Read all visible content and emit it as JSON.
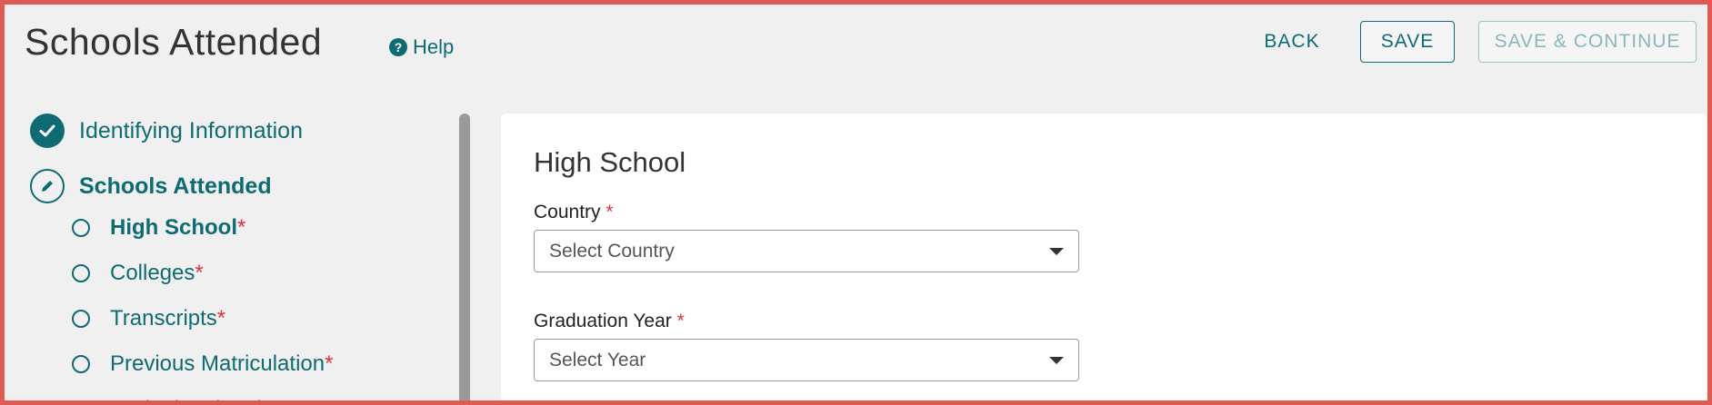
{
  "header": {
    "title": "Schools Attended",
    "help_label": "Help",
    "back_label": "BACK",
    "save_label": "SAVE",
    "save_continue_label": "SAVE & CONTINUE"
  },
  "sidebar": {
    "sections": [
      {
        "label": "Identifying Information",
        "status": "complete"
      },
      {
        "label": "Schools Attended",
        "status": "editing"
      }
    ],
    "items": [
      {
        "label": "High School",
        "required_mark": "*"
      },
      {
        "label": "Colleges",
        "required_mark": "*"
      },
      {
        "label": "Transcripts",
        "required_mark": "*"
      },
      {
        "label": "Previous Matriculation",
        "required_mark": "*"
      },
      {
        "label": "Institutional Action",
        "required_mark": "*"
      }
    ]
  },
  "form": {
    "title": "High School",
    "country": {
      "label": "Country",
      "required_mark": "*",
      "placeholder": "Select Country"
    },
    "graduation_year": {
      "label": "Graduation Year",
      "required_mark": "*",
      "placeholder": "Select Year"
    }
  },
  "colors": {
    "accent": "#0e6b73",
    "required": "#d9333f",
    "frame_border": "#e05a54"
  }
}
